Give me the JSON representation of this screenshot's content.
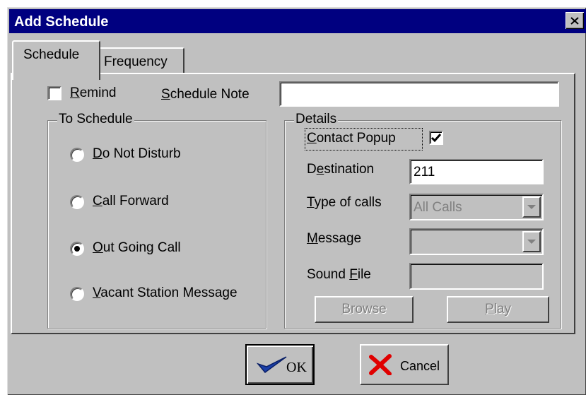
{
  "window": {
    "title": "Add Schedule"
  },
  "tabs": [
    {
      "label": "Schedule",
      "active": true
    },
    {
      "label": "Frequency",
      "active": false
    }
  ],
  "remind": {
    "label_underlined": "R",
    "label_rest": "emind",
    "checked": false
  },
  "schedule_note": {
    "label_underlined": "S",
    "label_rest": "chedule Note",
    "value": ""
  },
  "to_schedule": {
    "title": "To Schedule",
    "options": [
      {
        "underlined": "D",
        "rest": "o Not Disturb",
        "selected": false
      },
      {
        "underlined": "C",
        "rest": "all Forward",
        "selected": false
      },
      {
        "underlined": "O",
        "rest": "ut Going Call",
        "selected": true
      },
      {
        "underlined": "V",
        "rest": "acant Station Message",
        "selected": false
      }
    ]
  },
  "details": {
    "title": "Details",
    "contact_popup": {
      "underlined": "C",
      "rest": "ontact Popup",
      "checked": true
    },
    "destination": {
      "pre": "D",
      "underlined": "e",
      "rest": "stination",
      "value": "211"
    },
    "type_of_calls": {
      "underlined": "T",
      "rest": "ype of calls",
      "value": "All Calls"
    },
    "message": {
      "underlined": "M",
      "rest": "essage",
      "value": ""
    },
    "sound_file": {
      "pre": "Sound ",
      "underlined": "F",
      "rest": "ile",
      "value": ""
    },
    "browse": {
      "underlined": "B",
      "rest": "rowse"
    },
    "play": {
      "underlined": "P",
      "rest": "lay"
    }
  },
  "buttons": {
    "ok": {
      "label": "OK"
    },
    "cancel": {
      "label": "Cancel"
    }
  },
  "colors": {
    "title_bar": "#000080",
    "face": "#c0c0c0",
    "ok_check": "#1b3fa8",
    "cancel_x": "#e00000"
  }
}
